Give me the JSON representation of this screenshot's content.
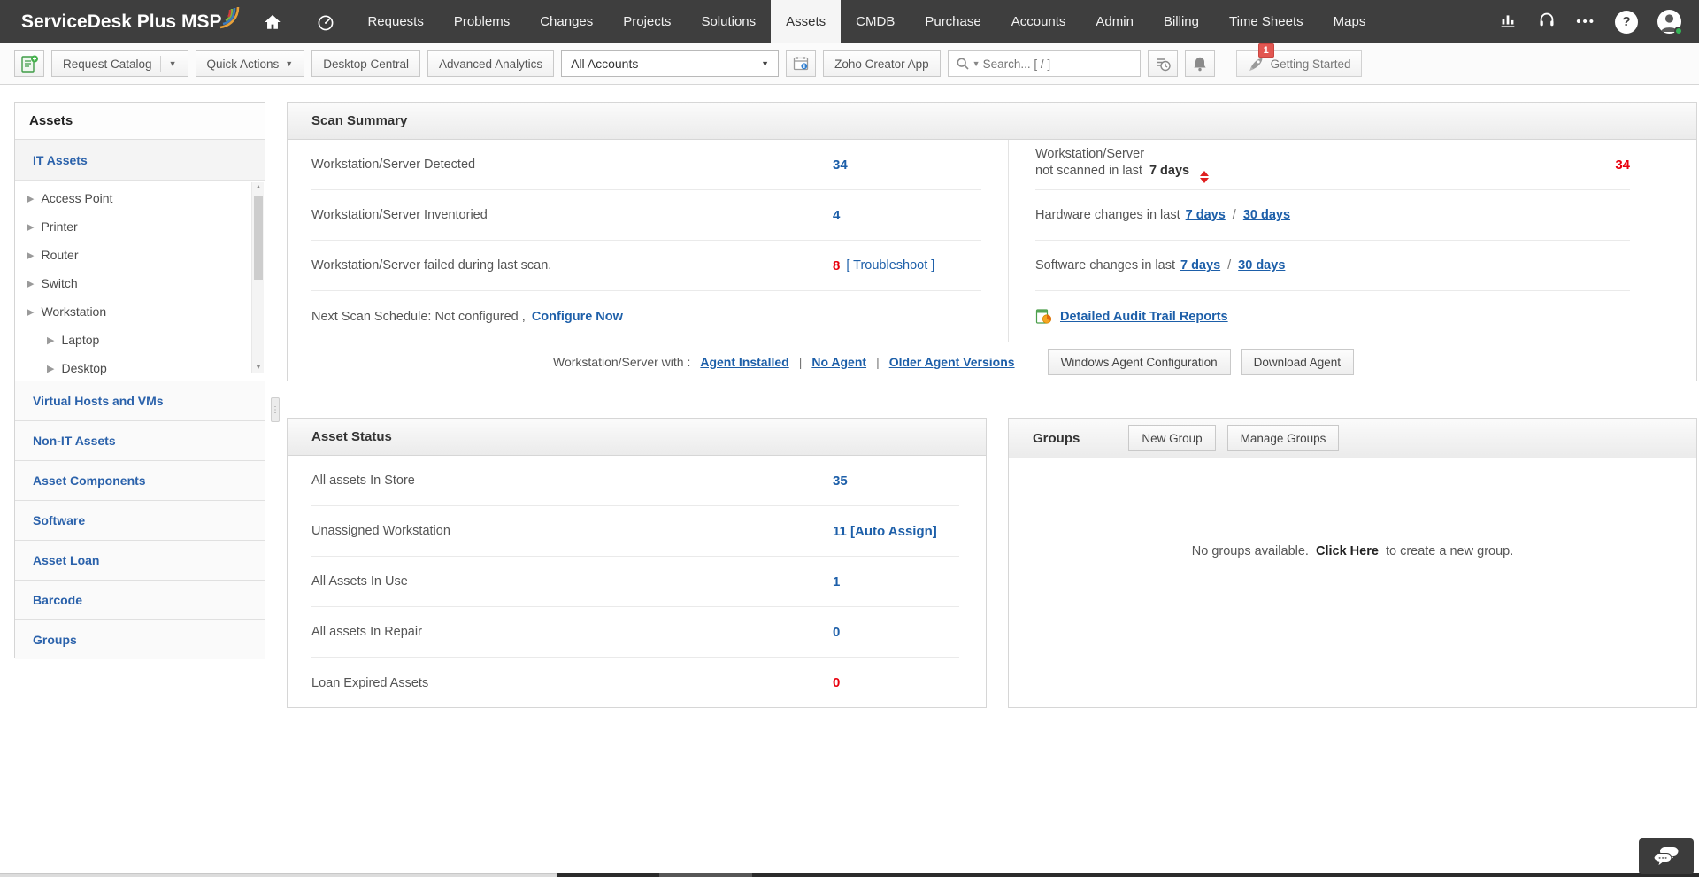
{
  "navbar": {
    "logo": "ServiceDesk Plus MSP",
    "items": [
      {
        "label": "Requests"
      },
      {
        "label": "Problems"
      },
      {
        "label": "Changes"
      },
      {
        "label": "Projects"
      },
      {
        "label": "Solutions"
      },
      {
        "label": "Assets"
      },
      {
        "label": "CMDB"
      },
      {
        "label": "Purchase"
      },
      {
        "label": "Accounts"
      },
      {
        "label": "Admin"
      },
      {
        "label": "Billing"
      },
      {
        "label": "Time Sheets"
      },
      {
        "label": "Maps"
      }
    ],
    "active_item": "Assets"
  },
  "toolbar": {
    "request_catalog_label": "Request Catalog",
    "quick_actions_label": "Quick Actions",
    "desktop_central_label": "Desktop Central",
    "advanced_analytics_label": "Advanced Analytics",
    "account_filter_value": "All Accounts",
    "zoho_creator_label": "Zoho Creator App",
    "search_placeholder": "Search... [ / ]",
    "notification_badge": "1",
    "getting_started_label": "Getting Started"
  },
  "sidebar": {
    "title": "Assets",
    "it_assets_label": "IT Assets",
    "tree": [
      {
        "label": "Access Point"
      },
      {
        "label": "Printer"
      },
      {
        "label": "Router"
      },
      {
        "label": "Switch"
      },
      {
        "label": "Workstation"
      },
      {
        "label": "Laptop"
      },
      {
        "label": "Desktop"
      }
    ],
    "sections": [
      {
        "label": "Virtual Hosts and VMs"
      },
      {
        "label": "Non-IT Assets"
      },
      {
        "label": "Asset Components"
      },
      {
        "label": "Software"
      },
      {
        "label": "Asset Loan"
      },
      {
        "label": "Barcode"
      },
      {
        "label": "Groups"
      }
    ]
  },
  "scan_summary": {
    "title": "Scan Summary",
    "left_rows": [
      {
        "label": "Workstation/Server Detected",
        "value": "34"
      },
      {
        "label": "Workstation/Server Inventoried",
        "value": "4"
      },
      {
        "label": "Workstation/Server failed during last scan.",
        "value": "8",
        "action": "[ Troubleshoot ]"
      }
    ],
    "schedule_row": {
      "text": "Next Scan Schedule: Not configured ,",
      "link": "Configure Now"
    },
    "right_rows": {
      "not_scanned": {
        "line1": "Workstation/Server",
        "line2": "not scanned in last",
        "bold": "7 days",
        "value": "34"
      },
      "hardware": {
        "text": "Hardware changes in last",
        "link7": "7 days",
        "sep": "/",
        "link30": "30 days"
      },
      "software": {
        "text": "Software changes in last",
        "link7": "7 days",
        "sep": "/",
        "link30": "30 days"
      },
      "audit": {
        "link": "Detailed Audit Trail Reports"
      }
    },
    "agent_row": {
      "label": "Workstation/Server with :",
      "links": [
        {
          "label": "Agent Installed"
        },
        {
          "label": "No Agent"
        },
        {
          "label": "Older Agent Versions"
        }
      ],
      "sep": "|",
      "buttons": [
        {
          "label": "Windows Agent Configuration"
        },
        {
          "label": "Download Agent"
        }
      ]
    }
  },
  "asset_status": {
    "title": "Asset Status",
    "rows": [
      {
        "label": "All assets In Store",
        "value": "35"
      },
      {
        "label": "Unassigned Workstation",
        "value": "11 [Auto Assign]"
      },
      {
        "label": "All Assets In Use",
        "value": "1"
      },
      {
        "label": "All assets In Repair",
        "value": "0"
      },
      {
        "label": "Loan Expired Assets",
        "value": "0"
      }
    ]
  },
  "groups": {
    "title": "Groups",
    "new_group_label": "New Group",
    "manage_groups_label": "Manage Groups",
    "empty_prefix": "No groups available.",
    "empty_link": "Click Here",
    "empty_suffix": "to create a new group."
  },
  "colors": {
    "navbar_bg": "#3e3e3e",
    "accent_blue": "#1d5fa9",
    "alert_red": "#e8000d",
    "active_tab_bg": "#f5f5f5"
  }
}
